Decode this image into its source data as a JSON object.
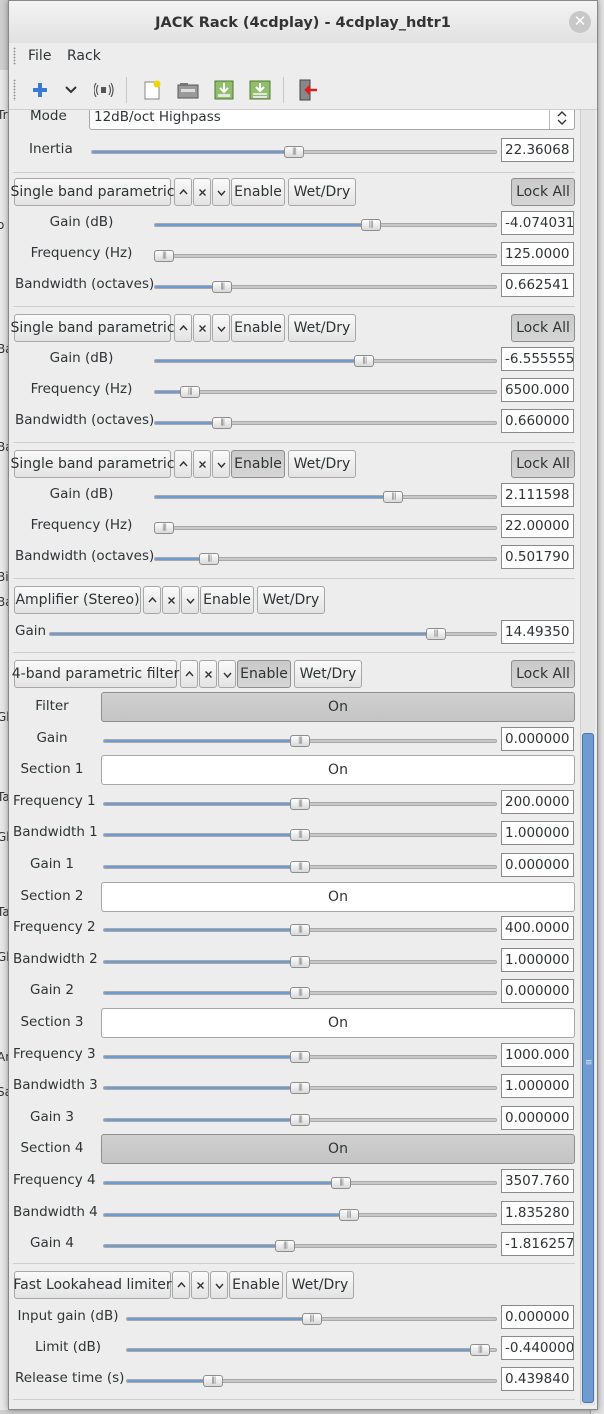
{
  "window": {
    "title": "JACK Rack (4cdplay) - 4cdplay_hdtr1",
    "close": "✕"
  },
  "menu": {
    "file": "File",
    "rack": "Rack"
  },
  "background": {
    "fragments": [
      "Tr",
      "o",
      "Ba",
      "Ba",
      "Bi",
      "Ba",
      "Gl",
      "Ta",
      "Gl",
      "Ta",
      "Gl",
      "Ar",
      "Sa"
    ]
  },
  "topcontrols": {
    "mode_label": "Mode",
    "mode_value": "12dB/oct Highpass",
    "inertia_label": "Inertia",
    "inertia_value": "22.36068",
    "inertia_pos": 0.5
  },
  "plugins": [
    {
      "name": "Single band parametric",
      "enable": "Enable",
      "wetdry": "Wet/Dry",
      "lockall": "Lock All",
      "enable_pressed": false,
      "params": [
        {
          "label": "Gain (dB)",
          "value": "-4.074031",
          "pos": 0.64
        },
        {
          "label": "Frequency (Hz)",
          "value": "125.0000",
          "pos": 0.0
        },
        {
          "label": "Bandwidth (octaves)",
          "value": "0.662541",
          "pos": 0.18
        }
      ]
    },
    {
      "name": "Single band parametric",
      "enable": "Enable",
      "wetdry": "Wet/Dry",
      "lockall": "Lock All",
      "enable_pressed": false,
      "params": [
        {
          "label": "Gain (dB)",
          "value": "-6.555555",
          "pos": 0.62
        },
        {
          "label": "Frequency (Hz)",
          "value": "6500.000",
          "pos": 0.08
        },
        {
          "label": "Bandwidth (octaves)",
          "value": "0.660000",
          "pos": 0.18
        }
      ]
    },
    {
      "name": "Single band parametric",
      "enable": "Enable",
      "wetdry": "Wet/Dry",
      "lockall": "Lock All",
      "enable_pressed": true,
      "params": [
        {
          "label": "Gain (dB)",
          "value": "2.111598",
          "pos": 0.71
        },
        {
          "label": "Frequency (Hz)",
          "value": "22.00000",
          "pos": 0.0
        },
        {
          "label": "Bandwidth (octaves)",
          "value": "0.501790",
          "pos": 0.14
        }
      ]
    }
  ],
  "amplifier": {
    "name": "Amplifier (Stereo)",
    "enable": "Enable",
    "wetdry": "Wet/Dry",
    "gain_label": "Gain",
    "gain_value": "14.49350",
    "gain_pos": 0.88
  },
  "fourband": {
    "name": "4-band parametric filter",
    "enable": "Enable",
    "wetdry": "Wet/Dry",
    "lockall": "Lock All",
    "on": "On",
    "rows": [
      {
        "type": "toggle",
        "label": "Filter",
        "pressed": true
      },
      {
        "type": "slider",
        "label": "Gain",
        "value": "0.000000",
        "pos": 0.5
      },
      {
        "type": "toggle",
        "label": "Section 1",
        "pressed": false
      },
      {
        "type": "slider",
        "label": "Frequency 1",
        "value": "200.0000",
        "pos": 0.5
      },
      {
        "type": "slider",
        "label": "Bandwidth 1",
        "value": "1.000000",
        "pos": 0.5
      },
      {
        "type": "slider",
        "label": "Gain 1",
        "value": "0.000000",
        "pos": 0.5
      },
      {
        "type": "toggle",
        "label": "Section 2",
        "pressed": false
      },
      {
        "type": "slider",
        "label": "Frequency 2",
        "value": "400.0000",
        "pos": 0.5
      },
      {
        "type": "slider",
        "label": "Bandwidth 2",
        "value": "1.000000",
        "pos": 0.5
      },
      {
        "type": "slider",
        "label": "Gain 2",
        "value": "0.000000",
        "pos": 0.5
      },
      {
        "type": "toggle",
        "label": "Section 3",
        "pressed": false
      },
      {
        "type": "slider",
        "label": "Frequency 3",
        "value": "1000.000",
        "pos": 0.5
      },
      {
        "type": "slider",
        "label": "Bandwidth 3",
        "value": "1.000000",
        "pos": 0.5
      },
      {
        "type": "slider",
        "label": "Gain 3",
        "value": "0.000000",
        "pos": 0.5
      },
      {
        "type": "toggle",
        "label": "Section 4",
        "pressed": true
      },
      {
        "type": "slider",
        "label": "Frequency 4",
        "value": "3507.760",
        "pos": 0.61
      },
      {
        "type": "slider",
        "label": "Bandwidth 4",
        "value": "1.835280",
        "pos": 0.63
      },
      {
        "type": "slider",
        "label": "Gain 4",
        "value": "-1.816257",
        "pos": 0.46
      }
    ]
  },
  "limiter": {
    "name": "Fast Lookahead limiter",
    "enable": "Enable",
    "wetdry": "Wet/Dry",
    "params": [
      {
        "label": "Input gain (dB)",
        "value": "0.000000",
        "pos": 0.5
      },
      {
        "label": "Limit (dB)",
        "value": "-0.440000",
        "pos": 0.98
      },
      {
        "label": "Release time (s)",
        "value": "0.439840",
        "pos": 0.22
      }
    ]
  },
  "icons": {
    "grip": "≡"
  }
}
